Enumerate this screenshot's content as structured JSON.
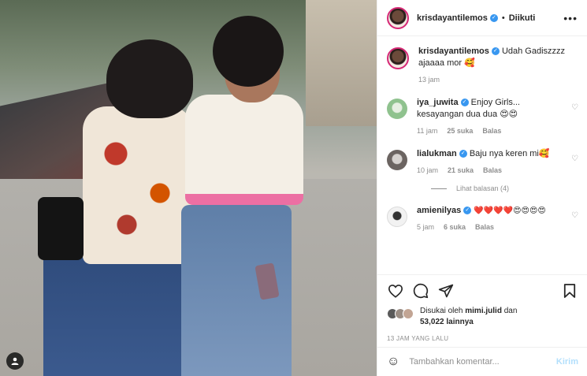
{
  "post": {
    "author": "krisdayantilemos",
    "follow_status": "Diikuti",
    "caption": "Udah Gadiszzzz ajaaaa mor 🥰",
    "caption_time": "13 jam"
  },
  "comments": [
    {
      "user": "iya_juwita",
      "text": "Enjoy Girls... kesayangan dua dua 😍😍",
      "time": "11 jam",
      "likes": "25 suka",
      "reply": "Balas"
    },
    {
      "user": "lialukman",
      "text": "Baju nya keren mi🥰",
      "time": "10 jam",
      "likes": "21 suka",
      "reply": "Balas",
      "view_replies": "Lihat balasan (4)"
    },
    {
      "user": "amienilyas",
      "text": "❤️❤️❤️❤️😍😍😍😍",
      "time": "5 jam",
      "likes": "6 suka",
      "reply": "Balas"
    }
  ],
  "likes": {
    "prefix": "Disukai oleh",
    "user": "mimi.julid",
    "joiner": "dan",
    "count": "53,022 lainnya"
  },
  "time_ago": "13 JAM YANG LALU",
  "add_comment": {
    "placeholder": "Tambahkan komentar...",
    "post_label": "Kirim"
  },
  "icons": {
    "more": "more-horizontal-icon",
    "like": "heart-icon",
    "comment": "comment-icon",
    "share": "send-icon",
    "save": "bookmark-icon",
    "emoji": "smiley-icon",
    "user_tag": "user-tag-icon"
  },
  "colors": {
    "verified": "#3897f0",
    "post_button_disabled": "#b2dffc"
  }
}
